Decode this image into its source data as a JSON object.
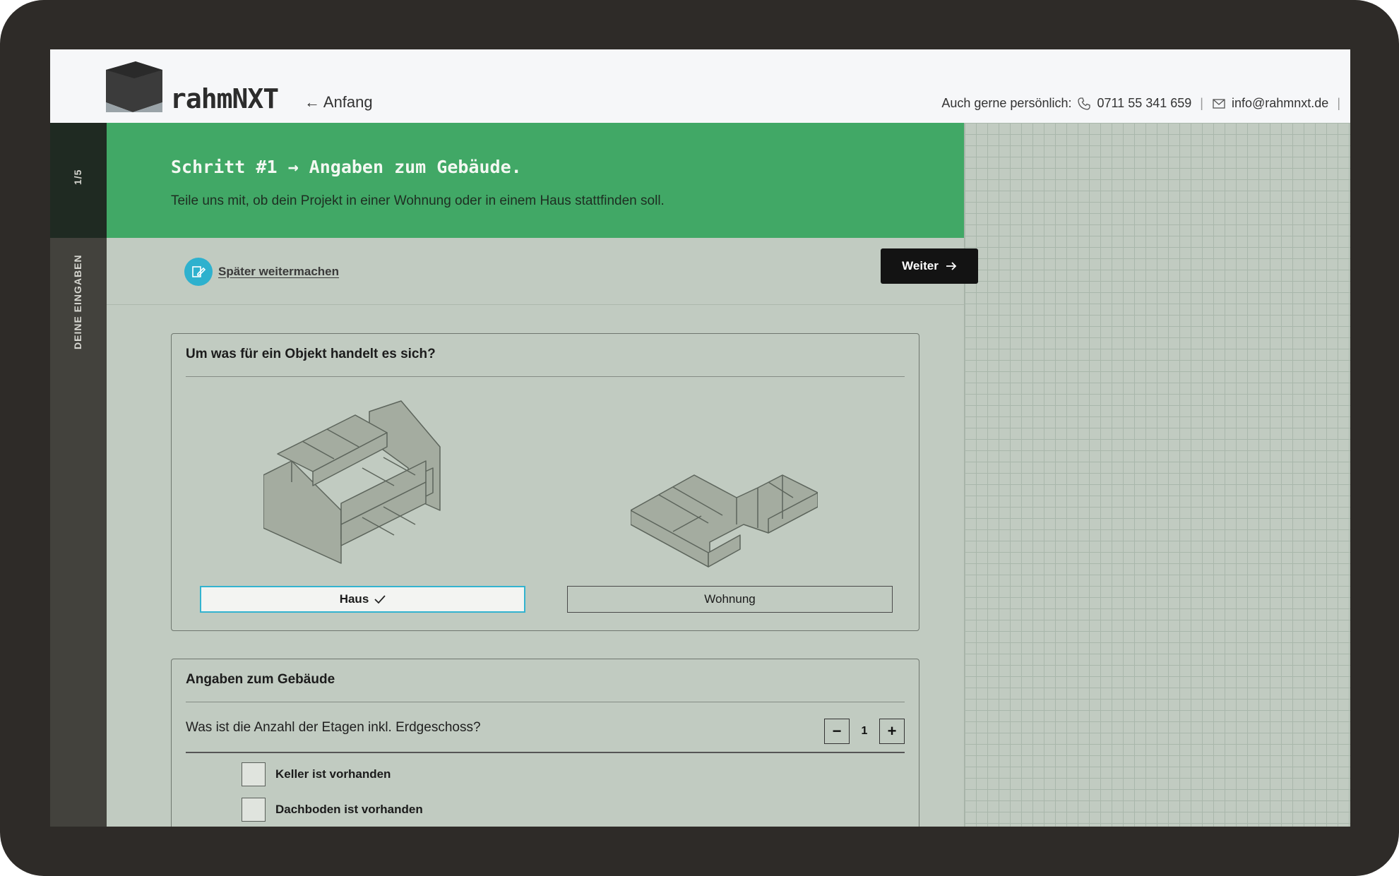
{
  "brand": {
    "name": "rahmNXT"
  },
  "header": {
    "back_label": "← Anfang",
    "contact_intro": "Auch gerne persönlich:",
    "phone": "0711 55 341 659",
    "email": "info@rahmnxt.de"
  },
  "sidebar": {
    "step_counter": "1/5",
    "section_label": "DEINE EINGABEN"
  },
  "step": {
    "title": "Schritt #1 → Angaben zum Gebäude.",
    "subtitle": "Teile uns mit, ob dein Projekt in einer Wohnung oder in einem Haus stattfinden soll."
  },
  "toolbar": {
    "later_label": "Später weitermachen",
    "next_label": "Weiter"
  },
  "object_card": {
    "title": "Um was für ein Objekt handelt es sich?",
    "options": [
      {
        "label": "Haus",
        "selected": true
      },
      {
        "label": "Wohnung",
        "selected": false
      }
    ]
  },
  "building_card": {
    "title": "Angaben zum Gebäude",
    "floors_question": "Was ist die Anzahl der Etagen inkl. Erdgeschoss?",
    "floors_value": "1",
    "decrement_label": "−",
    "increment_label": "+",
    "checkboxes": [
      {
        "label": "Keller ist vorhanden",
        "checked": false
      },
      {
        "label": "Dachboden ist vorhanden",
        "checked": false
      }
    ]
  },
  "colors": {
    "accent_green": "#41a866",
    "selection_blue": "#33b3cf",
    "background": "#c1cbc1"
  }
}
